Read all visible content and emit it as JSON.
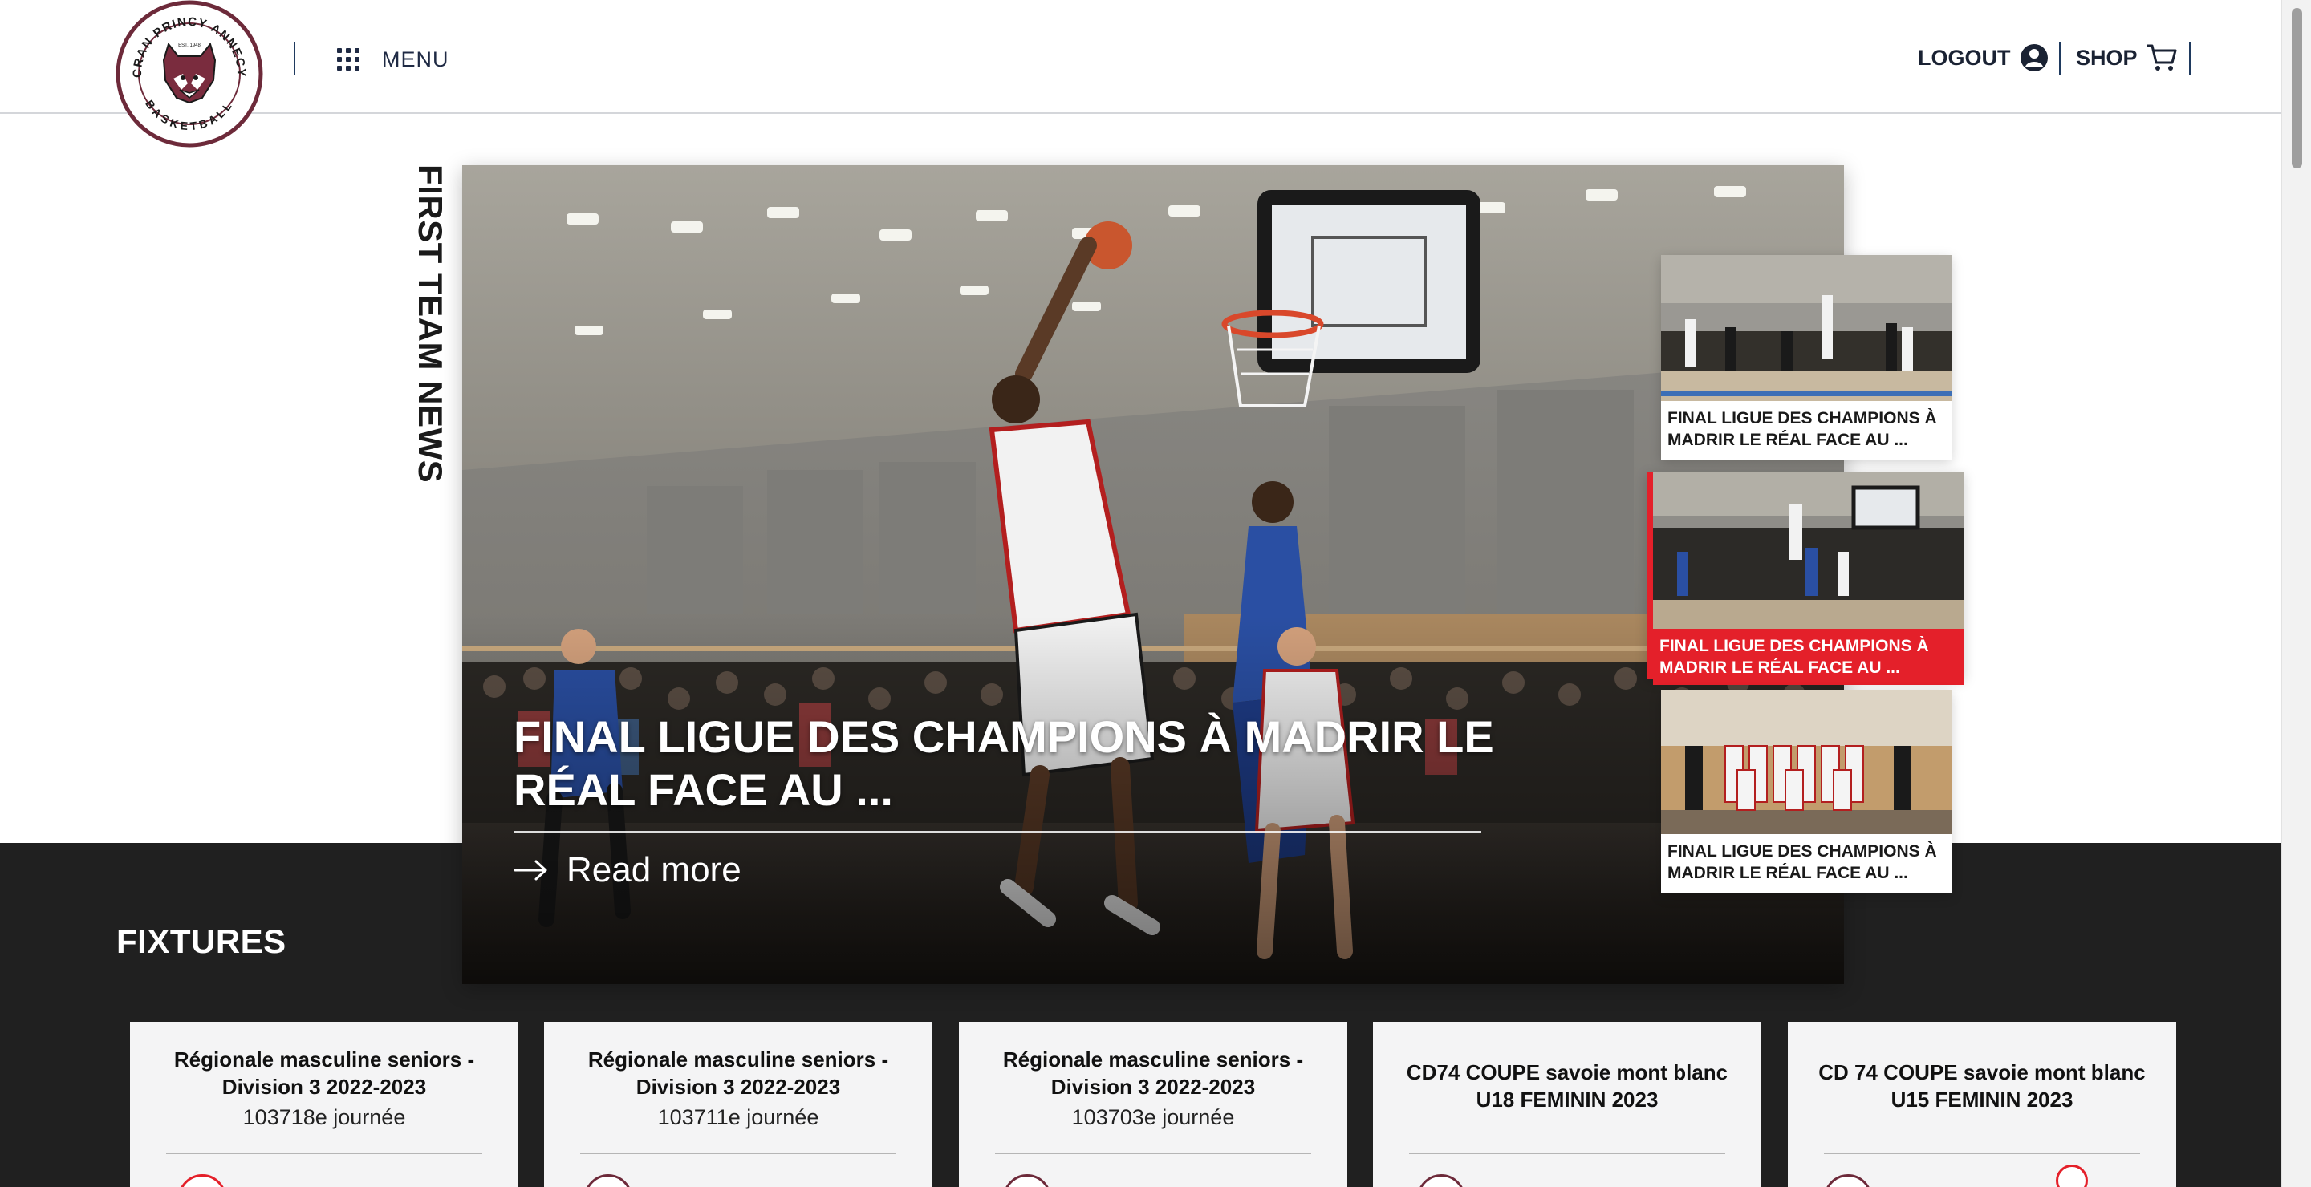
{
  "header": {
    "logo": {
      "text_top": "CRAN PRINCY ANNECY",
      "text_bottom": "BASKETBALL",
      "est": "EST. 1948",
      "icon": "lynx-mascot-icon"
    },
    "menu_label": "MENU",
    "logout_label": "LOGOUT",
    "shop_label": "SHOP"
  },
  "news": {
    "section_title": "FIRST TEAM NEWS",
    "hero": {
      "title": "FINAL LIGUE DES CHAMPIONS À MADRIR LE RÉAL FACE AU ...",
      "read_more": "Read more"
    },
    "thumbs": [
      {
        "caption": "FINAL LIGUE DES CHAMPIONS À MADRIR LE RÉAL FACE AU ...",
        "active": false
      },
      {
        "caption": "FINAL LIGUE DES CHAMPIONS À MADRIR LE RÉAL FACE AU ...",
        "active": true
      },
      {
        "caption": "FINAL LIGUE DES CHAMPIONS À MADRIR LE RÉAL FACE AU ...",
        "active": false
      }
    ]
  },
  "fixtures": {
    "title": "FIXTURES",
    "cards": [
      {
        "competition": "Régionale masculine seniors - Division 3 2022-2023",
        "matchday": "103718e journée"
      },
      {
        "competition": "Régionale masculine seniors - Division 3 2022-2023",
        "matchday": "103711e journée"
      },
      {
        "competition": "Régionale masculine seniors - Division 3 2022-2023",
        "matchday": "103703e journée"
      },
      {
        "competition": "CD74 COUPE savoie mont blanc U18 FEMININ 2023",
        "matchday": ""
      },
      {
        "competition": "CD 74 COUPE savoie mont blanc U15 FEMININ 2023",
        "matchday": ""
      }
    ]
  },
  "colors": {
    "accent_red": "#e4202a",
    "dark_band": "#202020",
    "brand_maroon": "#6d2a3a",
    "navy": "#1f2a44"
  }
}
